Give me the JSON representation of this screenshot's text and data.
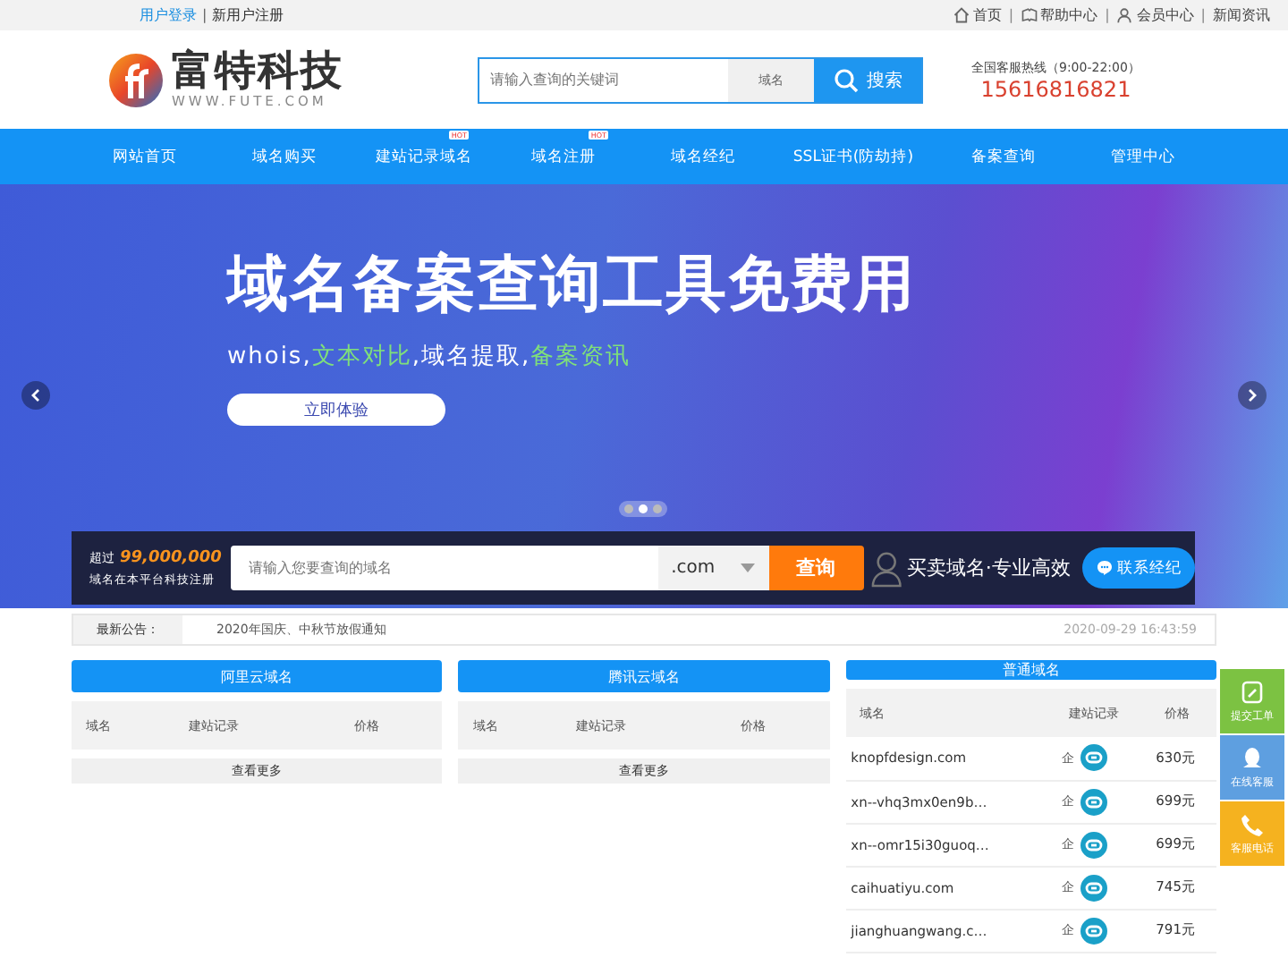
{
  "top_bar": {
    "login": "用户登录",
    "separator": "|",
    "register": "新用户注册",
    "links": [
      {
        "kind": "home",
        "label": "首页"
      },
      {
        "kind": "help",
        "label": "帮助中心"
      },
      {
        "kind": "user",
        "label": "会员中心"
      },
      {
        "kind": "none",
        "label": "新闻资讯"
      }
    ]
  },
  "header": {
    "logo_name": "富特科技",
    "logo_url": "WWW.FUTE.COM",
    "search": {
      "placeholder": "请输入查询的关键词",
      "scope": "域名",
      "button": "搜索"
    },
    "hotline_label": "全国客服热线（9:00-22:00）",
    "hotline": "15616816821"
  },
  "nav": [
    {
      "label": "网站首页"
    },
    {
      "label": "域名购买"
    },
    {
      "label": "建站记录域名",
      "badge": "HOT"
    },
    {
      "label": "域名注册",
      "badge": "HOT"
    },
    {
      "label": "域名经纪"
    },
    {
      "label": "SSL证书(防劫持)"
    },
    {
      "label": "备案查询"
    },
    {
      "label": "管理中心"
    }
  ],
  "banner": {
    "headline": "域名备案查询工具免费用",
    "subline": "whois,*文本对比*,域名提取,*备案资讯*",
    "button": "立即体验",
    "dots": [
      {
        "selected": false
      },
      {
        "selected": true
      },
      {
        "selected": false
      }
    ]
  },
  "domain_search": {
    "count_prefix": "超过",
    "count": "99,000,000",
    "count_caption": "域名在本平台科技注册",
    "placeholder": "请输入您要查询的域名",
    "suffix": ".com",
    "button": "查询",
    "slogan": "买卖域名·专业高效",
    "contact": "联系经纪"
  },
  "notice": {
    "label": "最新公告：",
    "items": [
      {
        "title": "2020年国庆、中秋节放假通知",
        "time": "2020-09-29 16:43:59"
      }
    ]
  },
  "panels": [
    {
      "title": "阿里云域名",
      "columns": [
        "域名",
        "建站记录",
        "价格"
      ],
      "more": "查看更多"
    },
    {
      "title": "腾讯云域名",
      "columns": [
        "域名",
        "建站记录",
        "价格"
      ],
      "more": "查看更多"
    },
    {
      "title": "普通域名",
      "columns": [
        "域名",
        "建站记录",
        "价格"
      ],
      "rows": [
        {
          "domain": "knopfdesign.com",
          "mark": "企",
          "price": "630元"
        },
        {
          "domain": "xn--vhq3mx0en9b…",
          "mark": "企",
          "price": "699元"
        },
        {
          "domain": "xn--omr15i30guoq…",
          "mark": "企",
          "price": "699元"
        },
        {
          "domain": "caihuatiyu.com",
          "mark": "企",
          "price": "745元"
        },
        {
          "domain": "jianghuangwang.c…",
          "mark": "企",
          "price": "791元"
        }
      ]
    }
  ],
  "float_bar": [
    {
      "kind": "ticket",
      "label": "提交工单",
      "color": "#7cc242"
    },
    {
      "kind": "chat",
      "label": "在线客服",
      "color": "#5e9fe0"
    },
    {
      "kind": "phone",
      "label": "客服电话",
      "color": "#f5b21f"
    }
  ]
}
